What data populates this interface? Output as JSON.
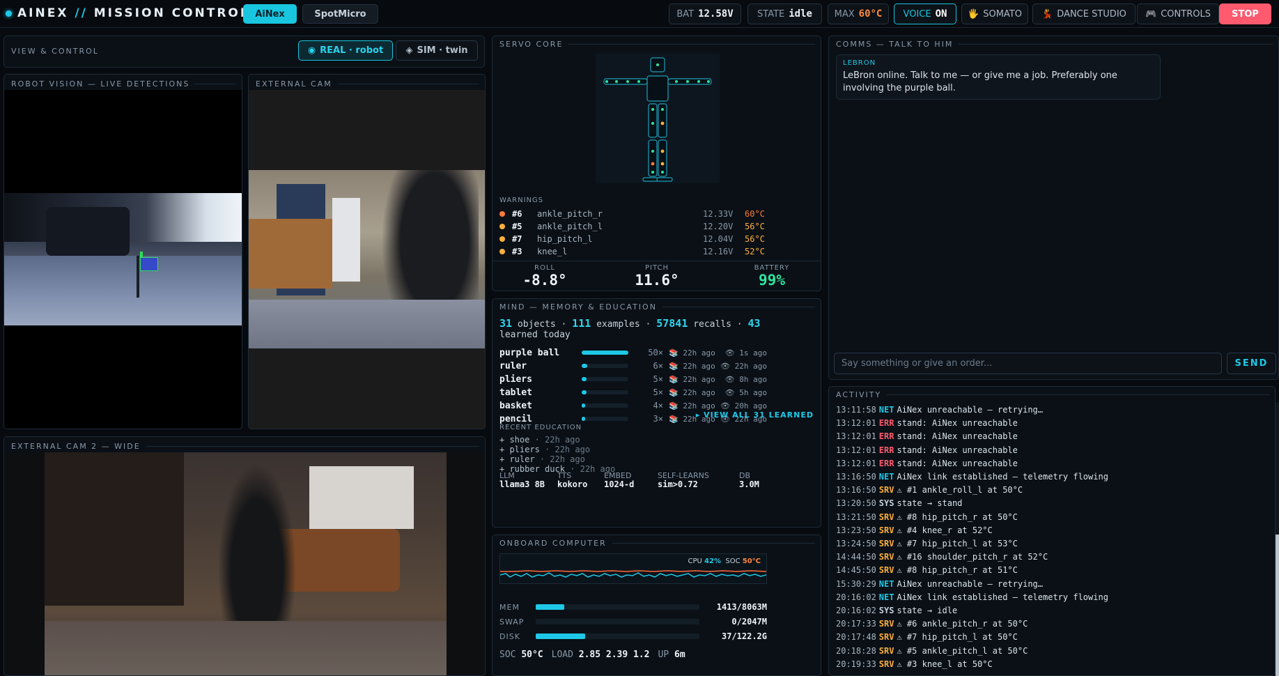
{
  "header": {
    "brand_prefix": "AINEX",
    "brand_slash": "//",
    "brand_suffix": "MISSION CONTROL",
    "robot_tabs": [
      {
        "label": "AiNex",
        "active": true
      },
      {
        "label": "SpotMicro",
        "active": false
      }
    ],
    "battery": {
      "label": "BAT",
      "value": "12.58V"
    },
    "state": {
      "label": "STATE",
      "value": "idle"
    },
    "max_temp": {
      "label": "MAX",
      "value": "60°C"
    },
    "voice": {
      "label": "VOICE",
      "value": "ON"
    },
    "somato": {
      "icon": "hand-icon",
      "glyph": "🖐",
      "label": "SOMATO"
    },
    "dance": {
      "icon": "dancer-icon",
      "glyph": "💃",
      "label": "DANCE STUDIO"
    },
    "controls": {
      "icon": "gamepad-icon",
      "glyph": "🎮",
      "label": "CONTROLS"
    },
    "stop_label": "STOP"
  },
  "view_control": {
    "title": "VIEW & CONTROL",
    "real": {
      "glyph": "◉",
      "label": "REAL · robot"
    },
    "sim": {
      "glyph": "◈",
      "label": "SIM · twin"
    }
  },
  "robot_vision": {
    "title": "ROBOT VISION — LIVE DETECTIONS"
  },
  "external_cam": {
    "title": "EXTERNAL CAM"
  },
  "external_cam2": {
    "title": "EXTERNAL CAM 2 — WIDE"
  },
  "servo_core": {
    "title": "SERVO CORE",
    "warnings_title": "WARNINGS",
    "warnings": [
      {
        "id": "#6",
        "name": "ankle_pitch_r",
        "voltage": "12.33V",
        "temp": "60°C",
        "color": "#ff7a3a"
      },
      {
        "id": "#5",
        "name": "ankle_pitch_l",
        "voltage": "12.20V",
        "temp": "56°C",
        "color": "#ffb03a"
      },
      {
        "id": "#7",
        "name": "hip_pitch_l",
        "voltage": "12.04V",
        "temp": "56°C",
        "color": "#ffb03a"
      },
      {
        "id": "#3",
        "name": "knee_l",
        "voltage": "12.16V",
        "temp": "52°C",
        "color": "#ffb03a"
      }
    ],
    "roll": {
      "label": "ROLL",
      "value": "-8.8°"
    },
    "pitch": {
      "label": "PITCH",
      "value": "11.6°"
    },
    "battery": {
      "label": "BATTERY",
      "value": "99%"
    }
  },
  "mind": {
    "title": "MIND — MEMORY & EDUCATION",
    "objects_count": "31",
    "objects_label": "objects",
    "examples_count": "111",
    "examples_label": "examples",
    "recalls_count": "57841",
    "recalls_label": "recalls",
    "learned_count": "43",
    "learned_label": "learned today",
    "objects": [
      {
        "name": "purple ball",
        "count": "50×",
        "fill": 1.0,
        "educated": "22h ago",
        "seen": "1s ago"
      },
      {
        "name": "ruler",
        "count": "6×",
        "fill": 0.12,
        "educated": "22h ago",
        "seen": "22h ago"
      },
      {
        "name": "pliers",
        "count": "5×",
        "fill": 0.1,
        "educated": "22h ago",
        "seen": "8h ago"
      },
      {
        "name": "tablet",
        "count": "5×",
        "fill": 0.1,
        "educated": "22h ago",
        "seen": "5h ago"
      },
      {
        "name": "basket",
        "count": "4×",
        "fill": 0.08,
        "educated": "22h ago",
        "seen": "20h ago"
      },
      {
        "name": "pencil",
        "count": "3×",
        "fill": 0.06,
        "educated": "22h ago",
        "seen": "22h ago"
      }
    ],
    "view_all": "▸ VIEW ALL 31 LEARNED",
    "recent_title": "RECENT EDUCATION",
    "recent": [
      {
        "name": "+ shoe",
        "when": "· 22h ago"
      },
      {
        "name": "+ pliers",
        "when": "· 22h ago"
      },
      {
        "name": "+ ruler",
        "when": "· 22h ago"
      },
      {
        "name": "+ rubber duck",
        "when": "· 22h ago"
      }
    ],
    "meta": [
      {
        "label": "LLM",
        "value": "llama3 8B"
      },
      {
        "label": "TTS",
        "value": "kokoro"
      },
      {
        "label": "EMBED",
        "value": "1024-d"
      },
      {
        "label": "SELF-LEARNS",
        "value": "sim>0.72"
      },
      {
        "label": "DB",
        "value": "3.0M"
      }
    ]
  },
  "onboard": {
    "title": "ONBOARD COMPUTER",
    "cpu_label": "CPU",
    "cpu_value": "42%",
    "soc_label": "SOC",
    "soc_value": "50°C",
    "resources": [
      {
        "label": "MEM",
        "value": "1413/8063M",
        "fill": 0.175
      },
      {
        "label": "SWAP",
        "value": "0/2047M",
        "fill": 0.0
      },
      {
        "label": "DISK",
        "value": "37/122.2G",
        "fill": 0.3
      }
    ],
    "soc_text_label": "SOC",
    "soc_text_value": "50°C",
    "load_label": "LOAD",
    "load_value": "2.85 2.39 1.2",
    "up_label": "UP",
    "up_value": "6m"
  },
  "comms": {
    "title": "COMMS — TALK TO HIM",
    "messages": [
      {
        "from": "LEBRON",
        "text": "LeBron online. Talk to me — or give me a job. Preferably one involving the purple ball."
      }
    ],
    "input_placeholder": "Say something or give an order...",
    "send_label": "SEND"
  },
  "activity": {
    "title": "ACTIVITY",
    "tag_colors": {
      "NET": "#1ec8e6",
      "ERR": "#ff5a6e",
      "SRV": "#ffb03a",
      "SYS": "#c8d2dc"
    },
    "entries": [
      {
        "time": "13:11:58",
        "tag": "NET",
        "text": "AiNex unreachable — retrying…"
      },
      {
        "time": "13:12:01",
        "tag": "ERR",
        "text": "stand: AiNex unreachable"
      },
      {
        "time": "13:12:01",
        "tag": "ERR",
        "text": "stand: AiNex unreachable"
      },
      {
        "time": "13:12:01",
        "tag": "ERR",
        "text": "stand: AiNex unreachable"
      },
      {
        "time": "13:12:01",
        "tag": "ERR",
        "text": "stand: AiNex unreachable"
      },
      {
        "time": "13:16:50",
        "tag": "NET",
        "text": "AiNex link established — telemetry flowing"
      },
      {
        "time": "13:16:50",
        "tag": "SRV",
        "text": "⚠ #1 ankle_roll_l at 50°C"
      },
      {
        "time": "13:20:50",
        "tag": "SYS",
        "text": "state → stand"
      },
      {
        "time": "13:21:50",
        "tag": "SRV",
        "text": "⚠ #8 hip_pitch_r at 50°C"
      },
      {
        "time": "13:23:50",
        "tag": "SRV",
        "text": "⚠ #4 knee_r at 52°C"
      },
      {
        "time": "13:24:50",
        "tag": "SRV",
        "text": "⚠ #7 hip_pitch_l at 53°C"
      },
      {
        "time": "14:44:50",
        "tag": "SRV",
        "text": "⚠ #16 shoulder_pitch_r at 52°C"
      },
      {
        "time": "14:45:50",
        "tag": "SRV",
        "text": "⚠ #8 hip_pitch_r at 51°C"
      },
      {
        "time": "15:30:29",
        "tag": "NET",
        "text": "AiNex unreachable — retrying…"
      },
      {
        "time": "20:16:02",
        "tag": "NET",
        "text": "AiNex link established — telemetry flowing"
      },
      {
        "time": "20:16:02",
        "tag": "SYS",
        "text": "state → idle"
      },
      {
        "time": "20:17:33",
        "tag": "SRV",
        "text": "⚠ #6 ankle_pitch_r at 50°C"
      },
      {
        "time": "20:17:48",
        "tag": "SRV",
        "text": "⚠ #7 hip_pitch_l at 50°C"
      },
      {
        "time": "20:18:28",
        "tag": "SRV",
        "text": "⚠ #5 ankle_pitch_l at 50°C"
      },
      {
        "time": "20:19:33",
        "tag": "SRV",
        "text": "⚠ #3 knee_l at 50°C"
      }
    ]
  },
  "colors": {
    "accent": "#1ec8e6",
    "stop": "#ff5a6e",
    "warn_hot": "#ff7a3a",
    "warn": "#ffb03a",
    "ok": "#2ee6a0"
  }
}
